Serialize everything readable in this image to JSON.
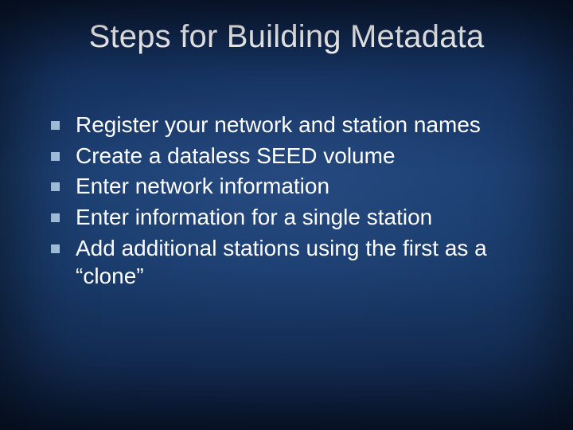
{
  "title": "Steps for Building Metadata",
  "bullets": [
    "Register your network and station names",
    "Create a dataless SEED volume",
    "Enter network information",
    "Enter information for a single station",
    "Add additional stations using the first as a “clone”"
  ]
}
